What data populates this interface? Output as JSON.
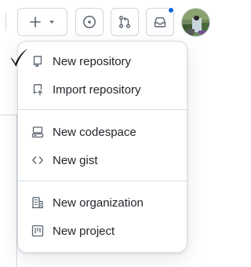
{
  "colors": {
    "accent": "#0969da",
    "border": "#d0d7de",
    "text": "#1f2328",
    "icon": "#59636e"
  },
  "header": {
    "create_button": {
      "icon": "plus-icon",
      "caret": "triangle-down-icon"
    },
    "issues_button": {
      "icon": "issue-opened-icon"
    },
    "pulls_button": {
      "icon": "git-pull-request-icon"
    },
    "inbox_button": {
      "icon": "inbox-icon",
      "has_notification": true
    },
    "avatar": {
      "icon": "user-avatar"
    }
  },
  "menu": {
    "groups": [
      [
        {
          "label": "New repository",
          "icon": "repo-icon"
        },
        {
          "label": "Import repository",
          "icon": "repo-push-icon"
        }
      ],
      [
        {
          "label": "New codespace",
          "icon": "codespaces-icon"
        },
        {
          "label": "New gist",
          "icon": "code-icon"
        }
      ],
      [
        {
          "label": "New organization",
          "icon": "organization-icon"
        },
        {
          "label": "New project",
          "icon": "project-icon"
        }
      ]
    ]
  }
}
